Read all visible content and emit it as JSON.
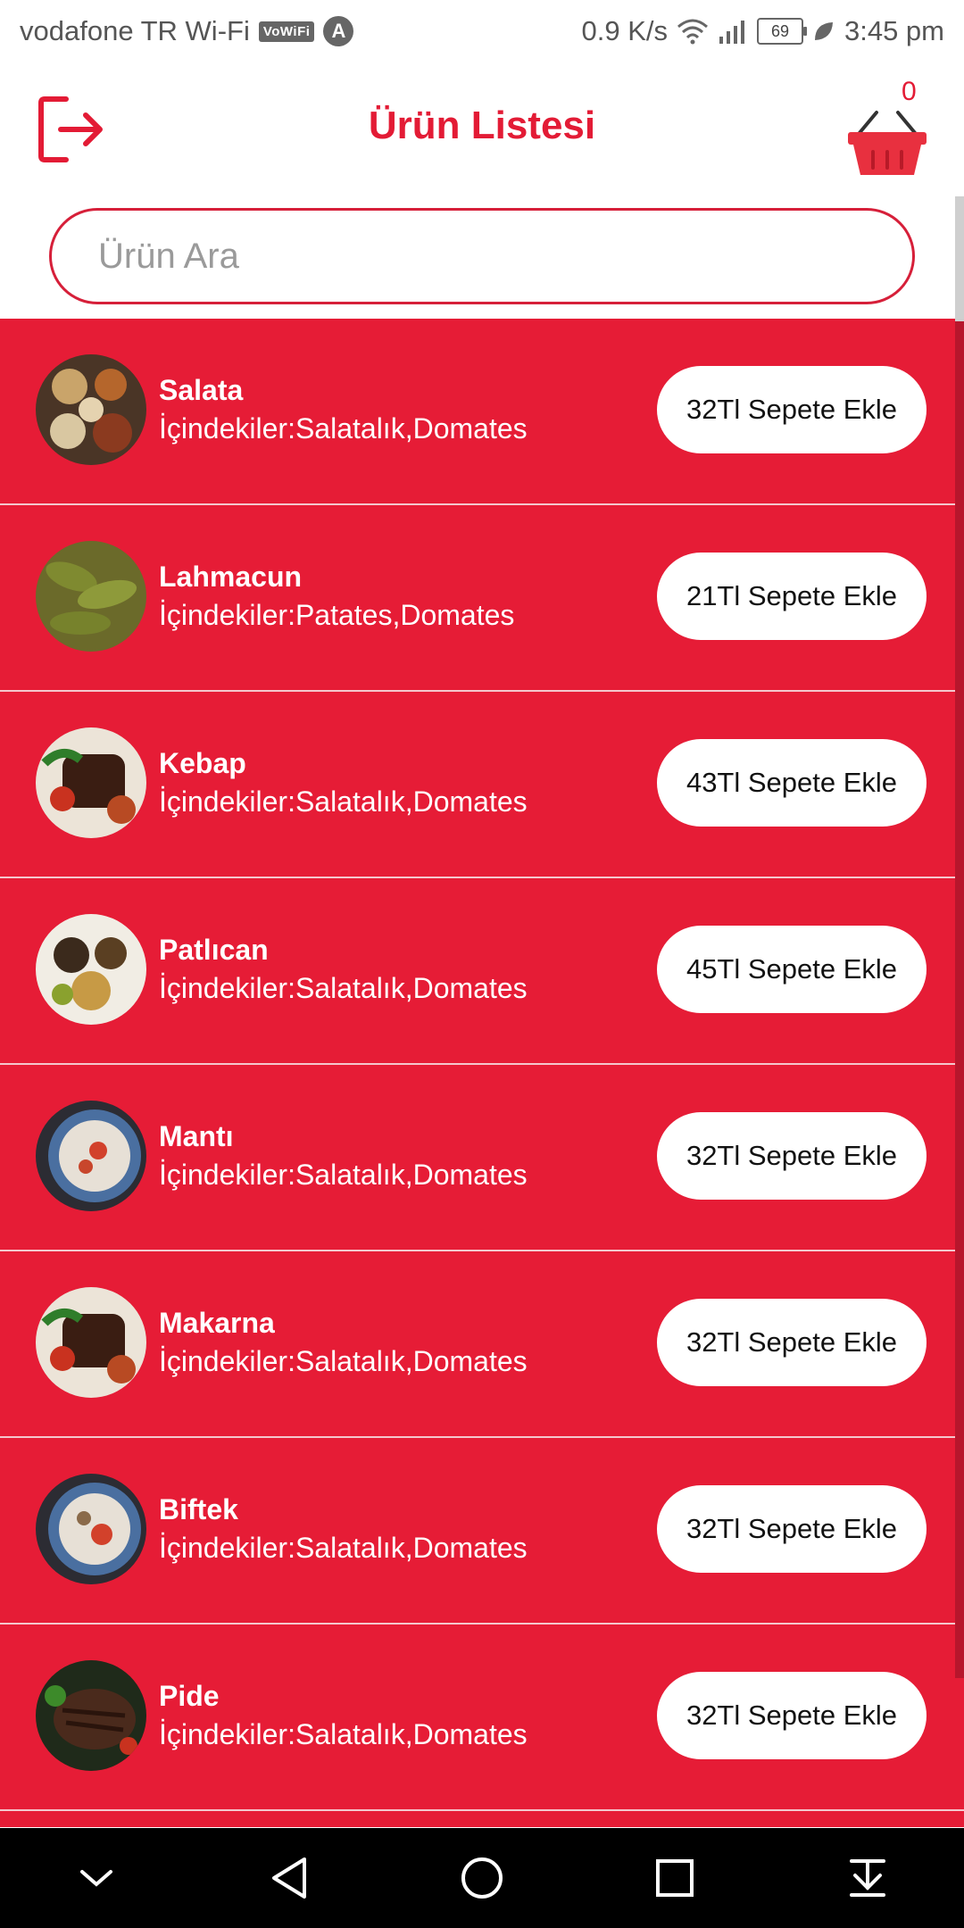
{
  "status_bar": {
    "carrier": "vodafone TR Wi-Fi",
    "vowifi_badge": "VoWiFi",
    "app_badge": "A",
    "speed": "0.9 K/s",
    "battery": "69",
    "time": "3:45 pm"
  },
  "header": {
    "title": "Ürün Listesi",
    "cart_count": "0",
    "logout_icon": "logout-icon",
    "cart_icon": "basket-icon",
    "accent_color": "#e31b35"
  },
  "search": {
    "placeholder": "Ürün Ara",
    "value": ""
  },
  "products": [
    {
      "name": "Salata",
      "ingredients": "İçindekiler:Salatalık,Domates",
      "button": "32Tl Sepete Ekle"
    },
    {
      "name": "Lahmacun",
      "ingredients": "İçindekiler:Patates,Domates",
      "button": "21Tl Sepete Ekle"
    },
    {
      "name": "Kebap",
      "ingredients": "İçindekiler:Salatalık,Domates",
      "button": "43Tl Sepete Ekle"
    },
    {
      "name": "Patlıcan",
      "ingredients": "İçindekiler:Salatalık,Domates",
      "button": "45Tl Sepete Ekle"
    },
    {
      "name": "Mantı",
      "ingredients": "İçindekiler:Salatalık,Domates",
      "button": "32Tl Sepete Ekle"
    },
    {
      "name": "Makarna",
      "ingredients": "İçindekiler:Salatalık,Domates",
      "button": "32Tl Sepete Ekle"
    },
    {
      "name": "Biftek",
      "ingredients": "İçindekiler:Salatalık,Domates",
      "button": "32Tl Sepete Ekle"
    },
    {
      "name": "Pide",
      "ingredients": "İçindekiler:Salatalık,Domates",
      "button": "32Tl Sepete Ekle"
    }
  ],
  "list_color": "#e61c36",
  "nav": [
    "chevron-down-icon",
    "back-icon",
    "home-icon",
    "recents-icon",
    "download-icon"
  ]
}
